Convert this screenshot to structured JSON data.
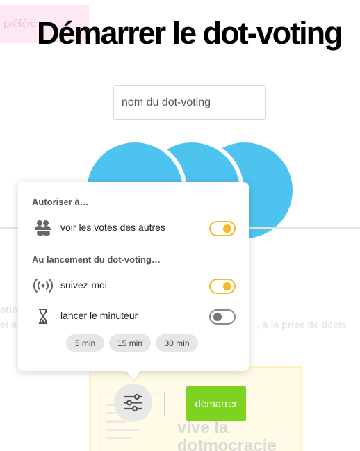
{
  "preferences_tab": {
    "label": "préfére"
  },
  "header": {
    "title": "Démarrer le dot-voting"
  },
  "name_input": {
    "value": "",
    "placeholder": "nom du dot-voting"
  },
  "background_text": {
    "line1": "otin",
    "line2": "et a",
    "line3": ", à la prise de décis"
  },
  "preview": {
    "text_line1": "vive la",
    "text_line2": "dotmocracie"
  },
  "colors": {
    "accent_blue": "#4fc3f0",
    "toggle_yellow": "#f5b921",
    "start_green": "#7ed321"
  },
  "popover": {
    "section_allow": "Autoriser à…",
    "see_votes": {
      "label": "voir les votes des autres",
      "icon": "group-coins-icon",
      "enabled": true
    },
    "section_launch": "Au lancement du dot-voting…",
    "follow_me": {
      "label": "suivez-moi",
      "icon": "broadcast-icon",
      "enabled": true
    },
    "timer": {
      "label": "lancer le minuteur",
      "icon": "hourglass-icon",
      "enabled": false
    },
    "durations": [
      "5 min",
      "15 min",
      "30 min"
    ]
  },
  "footer": {
    "settings_icon": "sliders-icon",
    "start_label": "démarrer"
  }
}
